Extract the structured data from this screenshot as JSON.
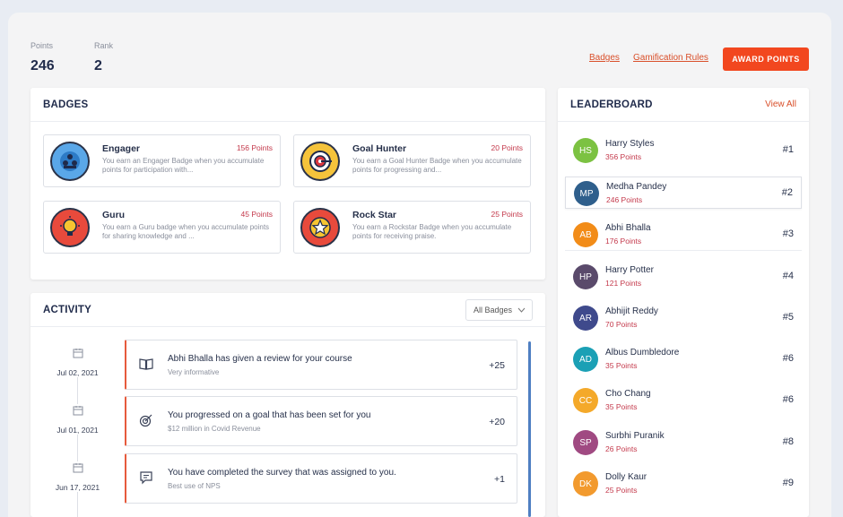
{
  "stats": {
    "points_label": "Points",
    "points_value": "246",
    "rank_label": "Rank",
    "rank_value": "2"
  },
  "header_links": {
    "badges": "Badges",
    "rules": "Gamification Rules",
    "award": "AWARD POINTS"
  },
  "badges_panel": {
    "title": "BADGES",
    "items": [
      {
        "name": "Engager",
        "points": "156 Points",
        "desc": "You earn an Engager Badge when you accumulate points for participation with...",
        "icon": "team-badge-icon"
      },
      {
        "name": "Goal Hunter",
        "points": "20 Points",
        "desc": "You earn a Goal Hunter Badge when you accumulate points for progressing and...",
        "icon": "target-badge-icon"
      },
      {
        "name": "Guru",
        "points": "45 Points",
        "desc": "You earn a Guru badge when you accumulate points for sharing knowledge and ...",
        "icon": "lightbulb-badge-icon"
      },
      {
        "name": "Rock Star",
        "points": "25 Points",
        "desc": "You earn a Rockstar Badge when you accumulate points for receiving praise.",
        "icon": "star-badge-icon"
      }
    ]
  },
  "activity_panel": {
    "title": "ACTIVITY",
    "filter": "All Badges",
    "items": [
      {
        "date": "Jul 02, 2021",
        "title": "Abhi Bhalla has given a review for your course",
        "sub": "Very informative",
        "points": "+25",
        "icon": "book-icon"
      },
      {
        "date": "Jul 01, 2021",
        "title": "You progressed on a goal that has been set for you",
        "sub": "$12 million in Covid Revenue",
        "points": "+20",
        "icon": "target-icon"
      },
      {
        "date": "Jun 17, 2021",
        "title": "You have completed the survey that was assigned to you.",
        "sub": "Best use of NPS",
        "points": "+1",
        "icon": "survey-icon"
      }
    ]
  },
  "leaderboard": {
    "title": "LEADERBOARD",
    "view_all": "View All",
    "rows": [
      {
        "initials": "HS",
        "name": "Harry Styles",
        "points": "356 Points",
        "rank": "#1",
        "color": "#7cc242"
      },
      {
        "initials": "MP",
        "name": "Medha Pandey",
        "points": "246 Points",
        "rank": "#2",
        "color": "#2f5f8c"
      },
      {
        "initials": "AB",
        "name": "Abhi Bhalla",
        "points": "176 Points",
        "rank": "#3",
        "color": "#f28c18"
      },
      {
        "initials": "HP",
        "name": "Harry Potter",
        "points": "121 Points",
        "rank": "#4",
        "color": "#5a4a6b"
      },
      {
        "initials": "AR",
        "name": "Abhijit Reddy",
        "points": "70 Points",
        "rank": "#5",
        "color": "#3f4a8c"
      },
      {
        "initials": "AD",
        "name": "Albus Dumbledore",
        "points": "35 Points",
        "rank": "#6",
        "color": "#1ba0b5"
      },
      {
        "initials": "CC",
        "name": "Cho Chang",
        "points": "35 Points",
        "rank": "#6",
        "color": "#f4a92a"
      },
      {
        "initials": "SP",
        "name": "Surbhi Puranik",
        "points": "26 Points",
        "rank": "#8",
        "color": "#a04a82"
      },
      {
        "initials": "DK",
        "name": "Dolly Kaur",
        "points": "25 Points",
        "rank": "#9",
        "color": "#f29a2e"
      }
    ]
  }
}
